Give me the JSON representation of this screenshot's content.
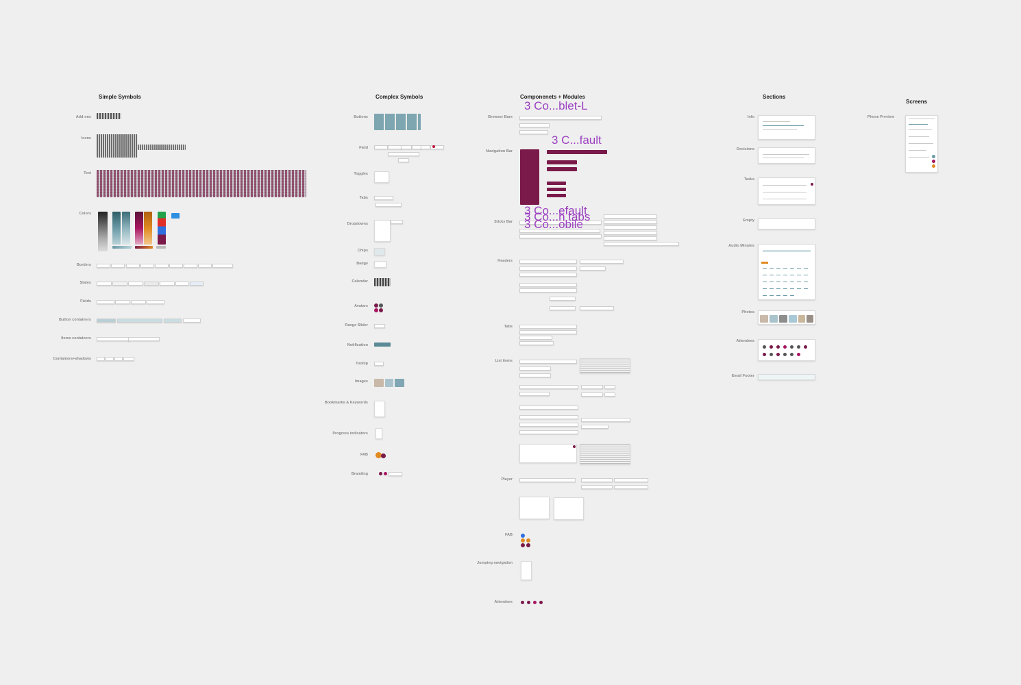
{
  "columns": {
    "simple": "Simple Symbols",
    "complex": "Complex Symbols",
    "components": "Componenets + Modules",
    "sections": "Sections",
    "screens": "Screens"
  },
  "simple_labels": {
    "addons": "Add-ons",
    "icons": "Icons",
    "text": "Text",
    "colors": "Colors",
    "borders": "Borders",
    "states": "States",
    "fields": "Fields",
    "button_containers": "Button containers",
    "items_containers": "Items containers",
    "containers_shadows": "Containers+shadows"
  },
  "complex_labels": {
    "buttons": "Buttons",
    "field": "Field",
    "toggles": "Toggles",
    "tabs": "Tabs",
    "dropdowns": "Dropdowns",
    "chips": "Chips",
    "badge": "Badge",
    "calendar": "Calendar",
    "avatars": "Avatars",
    "range_slider": "Range Slider",
    "notification": "Notification",
    "tooltip": "Tooltip",
    "images": "Images",
    "bookmarks": "Bookmarks & Keywords",
    "progress": "Progress indicators",
    "fab": "FAB",
    "branding": "Branding"
  },
  "component_labels": {
    "browser_bars": "Browser Bars",
    "navigation_bar": "Navigation Bar",
    "sticky_bar": "Sticky Bar",
    "headers": "Headers",
    "tabs": "Tabs",
    "list_items": "List items",
    "player": "Player",
    "fab": "FAB",
    "jumping_navigation": "Jumping navigation",
    "attendees": "Attendees"
  },
  "component_overlays": {
    "browser_bars": "3 Co...blet-L",
    "navigation_bar": "3 C...fault",
    "sticky_1": "3 Co...efault",
    "sticky_2": "3 Co...h tabs",
    "sticky_3": "3 Co...obile"
  },
  "section_labels": {
    "info": "Info",
    "decisions": "Decisions",
    "tasks": "Tasks",
    "empty": "Empty",
    "audio_minutes": "Audio Minutes",
    "photos": "Photos",
    "attendees": "Attendees",
    "email_footer": "Email Footer"
  },
  "screen_labels": {
    "phone_preview": "Phone Preview"
  },
  "palette": {
    "maroon": "#7a1a4a",
    "teal": "#6a9aa6",
    "purple_overlay": "#9b3fc0",
    "magenta": "#a8155f",
    "orange": "#e08a22",
    "blue": "#2f6fe0",
    "green": "#22a34a"
  }
}
